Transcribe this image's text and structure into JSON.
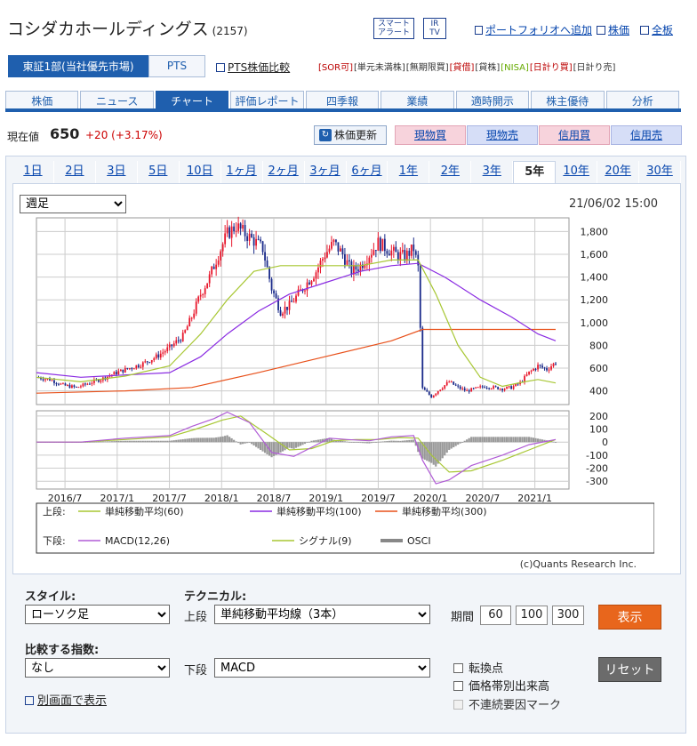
{
  "header": {
    "company_name": "コシダカホールディングス",
    "code": "(2157)",
    "smart_alert": [
      "スマート",
      "アラート"
    ],
    "irtv": [
      "IR",
      "TV"
    ],
    "portfolio_link": "ポートフォリオへ追加",
    "kabuka_link": "株価",
    "zenban_link": "全板"
  },
  "market": {
    "selected": "東証1部(当社優先市場)",
    "pts_tab": "PTS",
    "pts_compare": "PTS株価比較",
    "badges": [
      "[SOR可]",
      "[単元未満株]",
      "[無期限買]",
      "[貸借]",
      "[貸株]",
      "[NISA]",
      "[日計り買]",
      "[日計り売]"
    ]
  },
  "nav_tabs": [
    "株価",
    "ニュース",
    "チャート",
    "評価レポート",
    "四季報",
    "業績",
    "適時開示",
    "株主優待",
    "分析"
  ],
  "nav_active": 2,
  "price": {
    "label": "現在値",
    "value": "650",
    "change": "+20 (+3.17%)",
    "refresh": "株価更新",
    "buttons": [
      "現物買",
      "現物売",
      "信用買",
      "信用売"
    ]
  },
  "period_tabs": [
    "1日",
    "2日",
    "3日",
    "5日",
    "10日",
    "1ヶ月",
    "2ヶ月",
    "3ヶ月",
    "6ヶ月",
    "1年",
    "2年",
    "3年",
    "5年",
    "10年",
    "20年",
    "30年"
  ],
  "period_active": 12,
  "chart_controls": {
    "interval": "週足",
    "timestamp": "21/06/02 15:00"
  },
  "chart_data": {
    "type": "line",
    "upper_panel": {
      "series_kind": "candlestick weekly with simple moving averages",
      "x_ticks": [
        "2016/7",
        "2017/1",
        "2017/7",
        "2018/1",
        "2018/7",
        "2019/1",
        "2019/7",
        "2020/1",
        "2020/7",
        "2021/1"
      ],
      "y_ticks": [
        1800,
        1600,
        1400,
        1200,
        1000,
        800,
        600,
        400
      ],
      "ylim": [
        280,
        1920
      ],
      "price_path": [
        [
          0,
          520
        ],
        [
          6,
          500
        ],
        [
          12,
          450
        ],
        [
          18,
          430
        ],
        [
          24,
          470
        ],
        [
          30,
          510
        ],
        [
          36,
          560
        ],
        [
          42,
          600
        ],
        [
          48,
          640
        ],
        [
          54,
          700
        ],
        [
          60,
          780
        ],
        [
          66,
          880
        ],
        [
          70,
          1050
        ],
        [
          74,
          1250
        ],
        [
          78,
          1400
        ],
        [
          82,
          1600
        ],
        [
          86,
          1780
        ],
        [
          90,
          1850
        ],
        [
          94,
          1780
        ],
        [
          98,
          1720
        ],
        [
          102,
          1650
        ],
        [
          106,
          1300
        ],
        [
          110,
          1100
        ],
        [
          114,
          1150
        ],
        [
          118,
          1250
        ],
        [
          122,
          1350
        ],
        [
          126,
          1450
        ],
        [
          130,
          1600
        ],
        [
          134,
          1700
        ],
        [
          138,
          1600
        ],
        [
          142,
          1450
        ],
        [
          146,
          1500
        ],
        [
          150,
          1600
        ],
        [
          154,
          1700
        ],
        [
          158,
          1650
        ],
        [
          162,
          1600
        ],
        [
          166,
          1580
        ],
        [
          170,
          1650
        ],
        [
          172,
          1480
        ],
        [
          174,
          420
        ],
        [
          178,
          350
        ],
        [
          182,
          420
        ],
        [
          186,
          480
        ],
        [
          190,
          430
        ],
        [
          194,
          400
        ],
        [
          198,
          420
        ],
        [
          202,
          440
        ],
        [
          206,
          430
        ],
        [
          210,
          420
        ],
        [
          214,
          430
        ],
        [
          218,
          470
        ],
        [
          222,
          560
        ],
        [
          226,
          620
        ],
        [
          230,
          590
        ],
        [
          234,
          650
        ]
      ],
      "ma60": [
        [
          0,
          520
        ],
        [
          20,
          480
        ],
        [
          40,
          530
        ],
        [
          60,
          620
        ],
        [
          74,
          900
        ],
        [
          86,
          1200
        ],
        [
          98,
          1450
        ],
        [
          110,
          1500
        ],
        [
          122,
          1500
        ],
        [
          134,
          1500
        ],
        [
          146,
          1500
        ],
        [
          160,
          1550
        ],
        [
          172,
          1550
        ],
        [
          180,
          1250
        ],
        [
          190,
          800
        ],
        [
          200,
          520
        ],
        [
          210,
          440
        ],
        [
          220,
          480
        ],
        [
          226,
          500
        ],
        [
          234,
          470
        ]
      ],
      "ma100": [
        [
          0,
          560
        ],
        [
          20,
          520
        ],
        [
          40,
          540
        ],
        [
          60,
          560
        ],
        [
          74,
          700
        ],
        [
          86,
          900
        ],
        [
          100,
          1100
        ],
        [
          114,
          1250
        ],
        [
          130,
          1350
        ],
        [
          146,
          1450
        ],
        [
          160,
          1500
        ],
        [
          172,
          1520
        ],
        [
          184,
          1400
        ],
        [
          200,
          1200
        ],
        [
          214,
          1050
        ],
        [
          226,
          900
        ],
        [
          234,
          840
        ]
      ],
      "ma300": [
        [
          0,
          380
        ],
        [
          40,
          400
        ],
        [
          70,
          430
        ],
        [
          100,
          560
        ],
        [
          130,
          700
        ],
        [
          160,
          840
        ],
        [
          174,
          940
        ],
        [
          234,
          940
        ]
      ],
      "legend": [
        {
          "name": "単純移動平均(60)",
          "color": "#a8c734"
        },
        {
          "name": "単純移動平均(100)",
          "color": "#8a2be2"
        },
        {
          "name": "単純移動平均(300)",
          "color": "#e8501a"
        }
      ],
      "legend_prefix": "上段:"
    },
    "lower_panel": {
      "y_ticks": [
        200,
        100,
        0,
        -100,
        -200,
        -300
      ],
      "ylim": [
        -360,
        240
      ],
      "macd": [
        [
          0,
          0
        ],
        [
          20,
          0
        ],
        [
          40,
          30
        ],
        [
          60,
          50
        ],
        [
          70,
          120
        ],
        [
          80,
          180
        ],
        [
          86,
          230
        ],
        [
          96,
          150
        ],
        [
          106,
          -80
        ],
        [
          116,
          -110
        ],
        [
          124,
          -40
        ],
        [
          132,
          30
        ],
        [
          140,
          20
        ],
        [
          150,
          10
        ],
        [
          160,
          40
        ],
        [
          170,
          50
        ],
        [
          174,
          -140
        ],
        [
          180,
          -320
        ],
        [
          186,
          -290
        ],
        [
          196,
          -180
        ],
        [
          210,
          -100
        ],
        [
          222,
          -20
        ],
        [
          234,
          20
        ]
      ],
      "signal": [
        [
          0,
          0
        ],
        [
          20,
          0
        ],
        [
          40,
          20
        ],
        [
          60,
          40
        ],
        [
          72,
          100
        ],
        [
          84,
          170
        ],
        [
          92,
          200
        ],
        [
          104,
          60
        ],
        [
          114,
          -60
        ],
        [
          124,
          -50
        ],
        [
          134,
          10
        ],
        [
          144,
          20
        ],
        [
          154,
          20
        ],
        [
          164,
          35
        ],
        [
          172,
          30
        ],
        [
          178,
          -100
        ],
        [
          186,
          -230
        ],
        [
          196,
          -220
        ],
        [
          210,
          -140
        ],
        [
          222,
          -60
        ],
        [
          234,
          20
        ]
      ],
      "legend": [
        {
          "name": "MACD(12,26)",
          "color": "#b05bd6"
        },
        {
          "name": "シグナル(9)",
          "color": "#a8c734"
        },
        {
          "name": "OSCI",
          "color": "#888888"
        }
      ],
      "legend_prefix": "下段:"
    },
    "credit": "(c)Quants Research Inc."
  },
  "form": {
    "style_label": "スタイル:",
    "style_value": "ローソク足",
    "technical_label": "テクニカル:",
    "upper_label": "上段",
    "upper_value": "単純移動平均線（3本）",
    "period_label": "期間",
    "periods": [
      "60",
      "100",
      "300"
    ],
    "show_button": "表示",
    "compare_label": "比較する指数:",
    "compare_value": "なし",
    "lower_label": "下段",
    "lower_value": "MACD",
    "checkboxes": [
      "転換点",
      "価格帯別出来高",
      "不連続要因マーク"
    ],
    "reset_button": "リセット",
    "alt_view": "別画面で表示"
  }
}
